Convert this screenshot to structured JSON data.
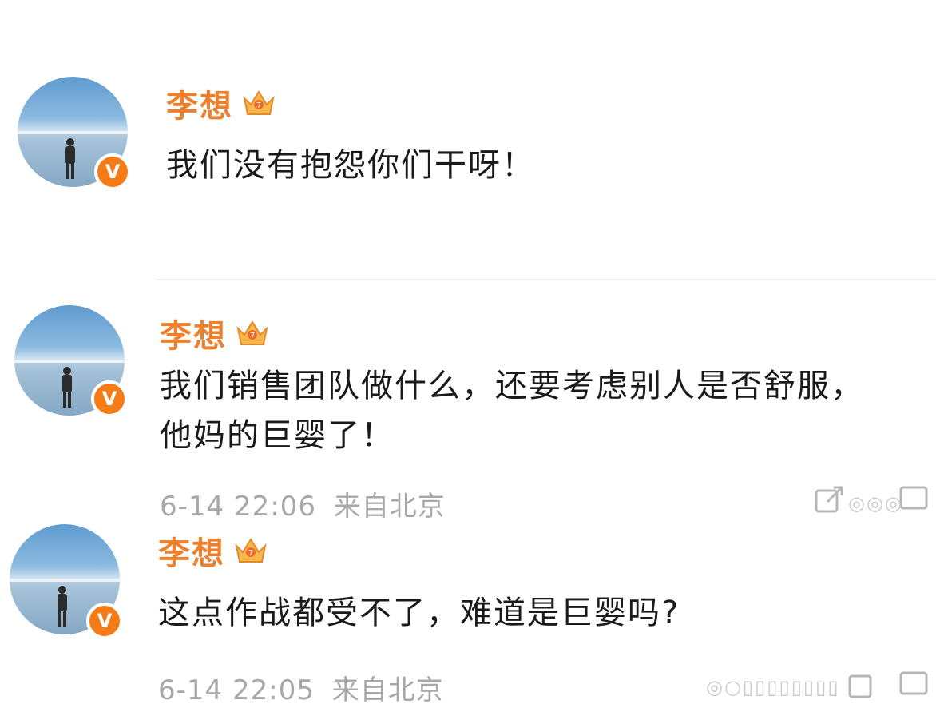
{
  "accent_color": "#ee7f2d",
  "badge_color": "#f57b16",
  "posts": [
    {
      "username": "李想",
      "content": "我们没有抱怨你们干呀！",
      "timestamp": "",
      "location": "",
      "badge": "V"
    },
    {
      "username": "李想",
      "content_line1": "我们销售团队做什么，还要考虑别人是否舒服，",
      "content_line2": "他妈的巨婴了！",
      "timestamp": "6-14 22:06",
      "location": "来自北京",
      "badge": "V"
    },
    {
      "username": "李想",
      "content": "这点作战都受不了，难道是巨婴吗?",
      "timestamp": "6-14 22:05",
      "location": "来自北京",
      "badge": "V"
    }
  ],
  "icons": [
    "avatar-photo",
    "verified-badge-icon",
    "crown-icon",
    "share-icon",
    "weibo-logo-icon",
    "comment-icon"
  ]
}
